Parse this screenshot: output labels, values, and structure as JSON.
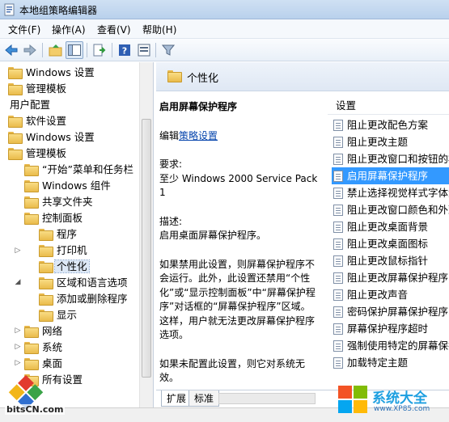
{
  "window": {
    "title": "本地组策略编辑器"
  },
  "menu": [
    "文件(F)",
    "操作(A)",
    "查看(V)",
    "帮助(H)"
  ],
  "toolbar": {
    "buttons": [
      "back-icon",
      "forward-icon",
      "up-folder-icon",
      "show-hide-tree-icon",
      "export-list-icon",
      "help-icon",
      "properties-icon",
      "filter-icon"
    ]
  },
  "tree": {
    "items": [
      {
        "label": "Windows 设置",
        "level": 0
      },
      {
        "label": "管理模板",
        "level": 0
      },
      {
        "label": "用户配置",
        "level": -1
      },
      {
        "label": "软件设置",
        "level": 0
      },
      {
        "label": "Windows 设置",
        "level": 0
      },
      {
        "label": "管理模板",
        "level": 0
      },
      {
        "label": "“开始”菜单和任务栏",
        "level": 1
      },
      {
        "label": "Windows 组件",
        "level": 1
      },
      {
        "label": "共享文件夹",
        "level": 1
      },
      {
        "label": "控制面板",
        "level": 1
      },
      {
        "label": "程序",
        "level": 2
      },
      {
        "label": "打印机",
        "level": 2
      },
      {
        "label": "个性化",
        "level": 2
      },
      {
        "label": "区域和语言选项",
        "level": 2
      },
      {
        "label": "添加或删除程序",
        "level": 2
      },
      {
        "label": "显示",
        "level": 2
      },
      {
        "label": "网络",
        "level": 1
      },
      {
        "label": "系统",
        "level": 1
      },
      {
        "label": "桌面",
        "level": 1
      },
      {
        "label": "所有设置",
        "level": 1
      }
    ],
    "selected_index": 12
  },
  "pane": {
    "title": "个性化"
  },
  "description": {
    "title": "启用屏幕保护程序",
    "edit_prefix": "编辑",
    "edit_link": "策略设置",
    "requirements_label": "要求:",
    "requirements_text": "至少 Windows 2000 Service Pack 1",
    "desc_label": "描述:",
    "desc_text": "启用桌面屏幕保护程序。",
    "para1": "如果禁用此设置，则屏幕保护程序不会运行。此外，此设置还禁用“个性化”或“显示控制面板”中“屏幕保护程序”对话框的“屏幕保护程序”区域。这样，用户就无法更改屏幕保护程序选项。",
    "para2": "如果未配置此设置，则它对系统无效。"
  },
  "settings": {
    "header": "设置",
    "items": [
      "阻止更改配色方案",
      "阻止更改主题",
      "阻止更改窗口和按钮的样式",
      "启用屏幕保护程序",
      "禁止选择视觉样式字体大小",
      "阻止更改窗口颜色和外观",
      "阻止更改桌面背景",
      "阻止更改桌面图标",
      "阻止更改鼠标指针",
      "阻止更改屏幕保护程序",
      "阻止更改声音",
      "密码保护屏幕保护程序",
      "屏幕保护程序超时",
      "强制使用特定的屏幕保护程序",
      "加载特定主题"
    ],
    "selected_index": 3
  },
  "tabs": [
    "扩展",
    "标准"
  ],
  "watermarks": {
    "left_text": "bitsCN.com",
    "right_title": "系统大全",
    "right_url": "www.XP85.com"
  },
  "colors": {
    "selection": "#3399ff",
    "link": "#0645ad",
    "folder": "#eabb4b"
  }
}
